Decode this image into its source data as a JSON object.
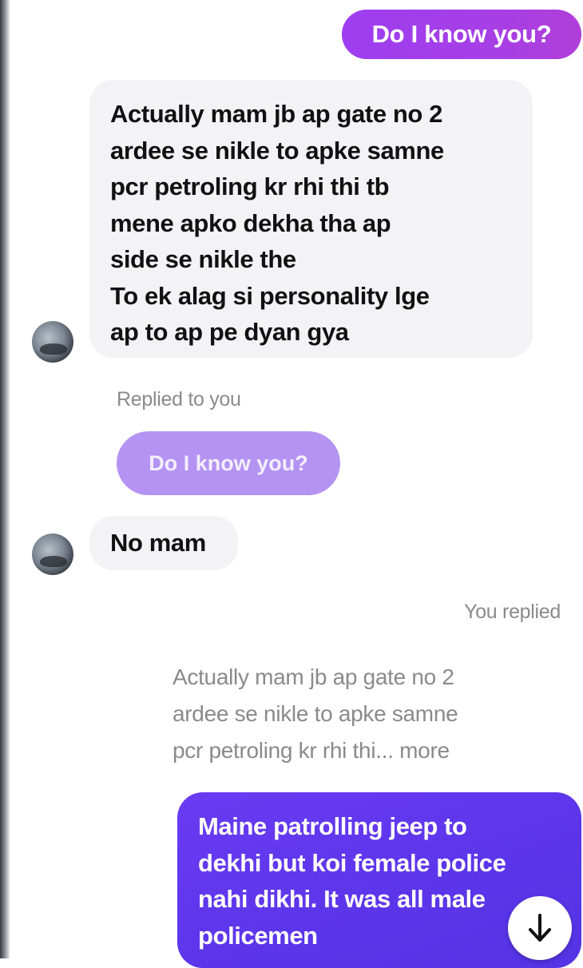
{
  "messages": {
    "outgoing_top": "Do I know you?",
    "incoming_1": {
      "lines": [
        "Actually mam jb ap gate no 2",
        "ardee se nikle to apke samne",
        "pcr petroling kr rhi thi tb",
        "mene apko dekha tha ap",
        "side se nikle the",
        "To ek alag si personality lge",
        "ap to ap pe dyan gya"
      ]
    },
    "replied_label": "Replied to you",
    "quoted_outgoing": "Do I know you?",
    "incoming_2": "No mam",
    "you_replied_label": "You replied",
    "quoted_incoming": {
      "lines": [
        "Actually mam jb ap gate no 2",
        "ardee se nikle to apke samne",
        "pcr petroling kr rhi thi... more"
      ]
    },
    "outgoing_bottom": {
      "lines": [
        "Maine patrolling jeep to",
        "dekhi but koi female police",
        "nahi dikhi. It was all male",
        "policemen"
      ]
    }
  },
  "icons": {
    "avatar": "avatar",
    "scroll_down": "arrow-down-icon"
  },
  "colors": {
    "outgoing_top_bubble": "#a63fe6",
    "outgoing_bottom_bubble": "#5b35ea",
    "incoming_bubble": "#f3f3f6",
    "quoted_outgoing_bubble": "#b493f3",
    "meta_text": "#8a8a8e"
  }
}
